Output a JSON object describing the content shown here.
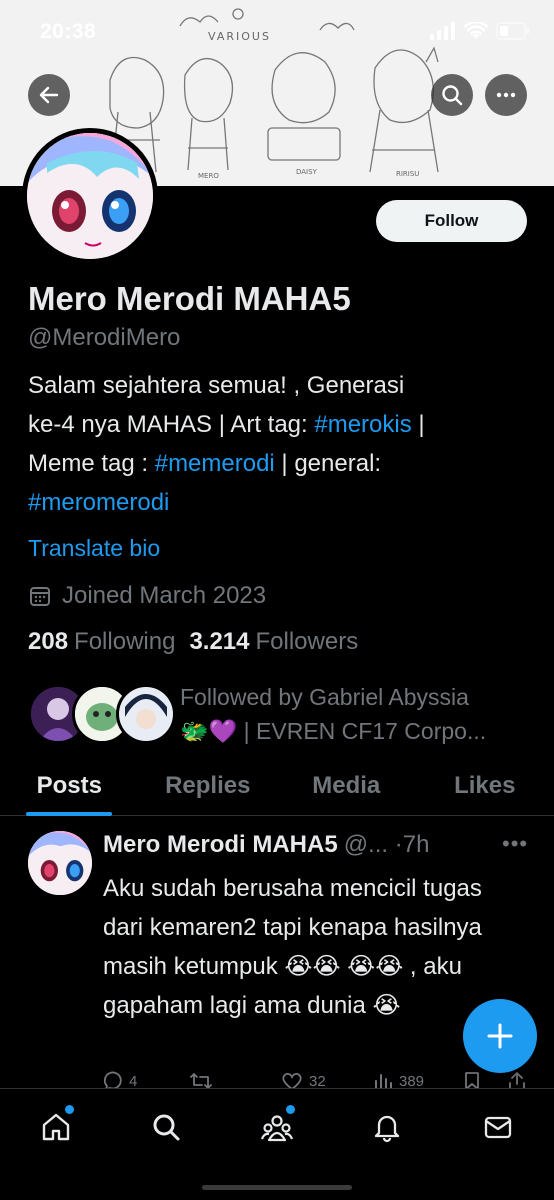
{
  "status_bar": {
    "time": "20:38"
  },
  "banner": {
    "doodle_title": "VARIOUS",
    "captions": [
      "MERO",
      "DAISY",
      "RIRISU"
    ]
  },
  "profile": {
    "display_name": "Mero Merodi MAHA5",
    "handle": "@MerodiMero",
    "follow_label": "Follow",
    "bio": {
      "line1": "Salam sejahtera semua! , Generasi",
      "line2_a": "ke-4 nya MAHAS | Art tag: ",
      "line2_tag": "#merokis",
      "line2_b": " |",
      "line3_a": "Meme tag : ",
      "line3_tag": "#memerodi",
      "line3_b": " | general:",
      "line4_tag": "#meromerodi"
    },
    "translate_label": "Translate bio",
    "joined": "Joined March 2023",
    "following_count": "208",
    "following_label": "Following",
    "followers_count": "3.214",
    "followers_label": "Followers",
    "followed_by_line1": "Followed by Gabriel Abyssia",
    "followed_by_line2": "🐲💜 | EVREN CF17 Corpo..."
  },
  "tabs": [
    {
      "label": "Posts",
      "active": true
    },
    {
      "label": "Replies",
      "active": false
    },
    {
      "label": "Media",
      "active": false
    },
    {
      "label": "Likes",
      "active": false
    }
  ],
  "tweet": {
    "name": "Mero Merodi MAHA5",
    "meta": "@... ·7h",
    "body": "Aku sudah berusaha mencicil tugas dari kemaren2 tapi kenapa hasilnya masih ketumpuk 😭😭 😭😭 , aku gapaham lagi ama dunia 😭",
    "replies": "4",
    "retweets": "",
    "likes": "32",
    "views": "389"
  },
  "colors": {
    "accent": "#1d9bf0",
    "background": "#000000",
    "muted": "#71767b",
    "text": "#e7e9ea"
  },
  "icons": [
    "back-arrow-icon",
    "search-icon",
    "more-icon",
    "calendar-icon",
    "reply-icon",
    "retweet-icon",
    "like-icon",
    "views-icon",
    "bookmark-icon",
    "share-icon",
    "plus-icon",
    "home-icon",
    "explore-icon",
    "communities-icon",
    "notifications-icon",
    "messages-icon"
  ]
}
